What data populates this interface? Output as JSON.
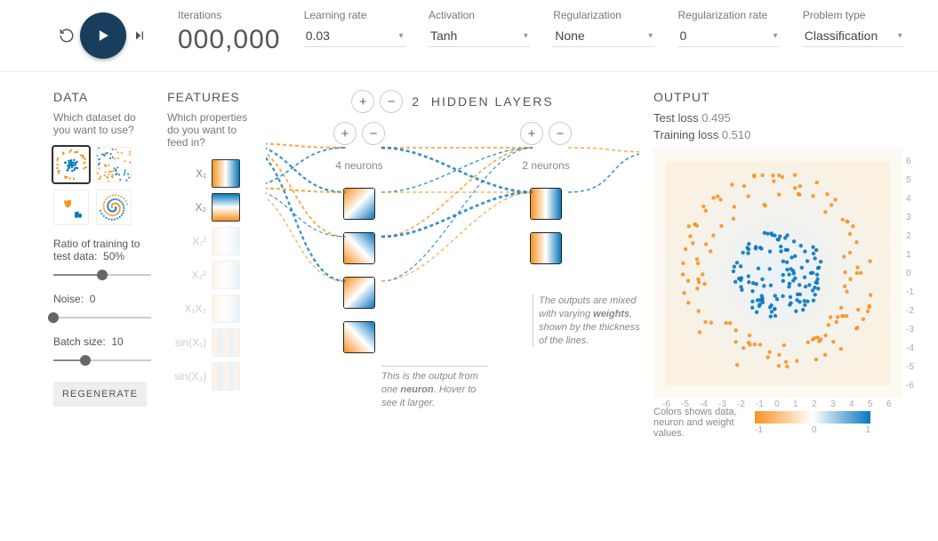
{
  "topbar": {
    "iterations_label": "Iterations",
    "iterations_value": "000,000",
    "learning_rate_label": "Learning rate",
    "learning_rate_value": "0.03",
    "activation_label": "Activation",
    "activation_value": "Tanh",
    "regularization_label": "Regularization",
    "regularization_value": "None",
    "regularization_rate_label": "Regularization rate",
    "regularization_rate_value": "0",
    "problem_label": "Problem type",
    "problem_value": "Classification"
  },
  "data": {
    "heading": "DATA",
    "question": "Which dataset do you want to use?",
    "datasets": [
      "circle",
      "xor",
      "gauss",
      "spiral"
    ],
    "selected_dataset_index": 0,
    "ratio_label": "Ratio of training to test data:",
    "ratio_value": "50%",
    "ratio_pct": 50,
    "noise_label": "Noise:",
    "noise_value": "0",
    "noise_pct": 0,
    "batch_label": "Batch size:",
    "batch_value": "10",
    "batch_pct": 33,
    "regenerate": "REGENERATE"
  },
  "features": {
    "heading": "FEATURES",
    "question": "Which properties do you want to feed in?",
    "inputs": [
      {
        "label": "X₁",
        "enabled": true,
        "grad": "grad-h"
      },
      {
        "label": "X₂",
        "enabled": true,
        "grad": "grad-v"
      },
      {
        "label": "X₁²",
        "enabled": false,
        "grad": "grad-pale"
      },
      {
        "label": "X₂²",
        "enabled": false,
        "grad": "grad-pale"
      },
      {
        "label": "X₁X₂",
        "enabled": false,
        "grad": "grad-pale"
      },
      {
        "label": "sin(X₁)",
        "enabled": false,
        "grad": "grad-stripe"
      },
      {
        "label": "sin(X₂)",
        "enabled": false,
        "grad": "grad-stripe"
      }
    ]
  },
  "network": {
    "hidden_layers_count": 2,
    "hidden_layers_label": "HIDDEN LAYERS",
    "layers": [
      {
        "neuron_count": 4,
        "label": "4 neurons"
      },
      {
        "neuron_count": 2,
        "label": "2 neurons"
      }
    ],
    "callout_weights": "The outputs are mixed with varying weights, shown by the thickness of the lines.",
    "callout_weights_html": "The outputs are mixed with varying <b>weights</b>, shown by the thickness of the lines.",
    "callout_neuron": "This is the output from one neuron. Hover to see it larger.",
    "callout_neuron_html": "This is the output from one <b>neuron</b>. Hover to see it larger."
  },
  "output": {
    "heading": "OUTPUT",
    "test_loss_label": "Test loss",
    "test_loss": "0.495",
    "train_loss_label": "Training loss",
    "train_loss": "0.510",
    "axis_ticks": [
      "-6",
      "-5",
      "-4",
      "-3",
      "-2",
      "-1",
      "0",
      "1",
      "2",
      "3",
      "4",
      "5",
      "6"
    ],
    "legend_text": "Colors shows data, neuron and weight values.",
    "legend_min": "-1",
    "legend_mid": "0",
    "legend_max": "1"
  },
  "chart_data": {
    "type": "scatter",
    "title": "",
    "xlabel": "",
    "ylabel": "",
    "xlim": [
      -6,
      6
    ],
    "ylim": [
      -6,
      6
    ],
    "series": [
      {
        "name": "inner (blue)",
        "color": "#0877bd",
        "description": "Inner circular cluster roughly within radius ≈ 2.5, centered near origin",
        "approx_center": [
          0,
          0
        ],
        "approx_radius": 2.5,
        "approx_point_count": 120
      },
      {
        "name": "outer (orange)",
        "color": "#f59322",
        "description": "Outer ring of points roughly at radius 3.5–5.5 around origin",
        "approx_center": [
          0,
          0
        ],
        "approx_radius_inner": 3.5,
        "approx_radius_outer": 5.5,
        "approx_point_count": 120
      }
    ]
  }
}
